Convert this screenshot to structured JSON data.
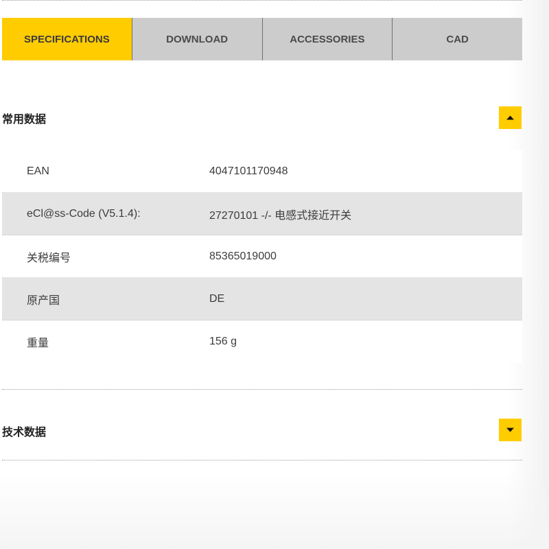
{
  "tabs": [
    {
      "label": "SPECIFICATIONS",
      "active": true
    },
    {
      "label": "DOWNLOAD",
      "active": false
    },
    {
      "label": "ACCESSORIES",
      "active": false
    },
    {
      "label": "CAD",
      "active": false
    }
  ],
  "general_section": {
    "title": "常用数据",
    "expanded": true,
    "toggle_icon": "chevron-up-icon",
    "rows": [
      {
        "label": "EAN",
        "value": "4047101170948"
      },
      {
        "label": "eCl@ss-Code (V5.1.4):",
        "value": "27270101 -/- 电感式接近开关"
      },
      {
        "label": "关税编号",
        "value": "85365019000"
      },
      {
        "label": "原产国",
        "value": "DE"
      },
      {
        "label": "重量",
        "value": "156 g"
      }
    ]
  },
  "technical_section": {
    "title": "技术数据",
    "expanded": false,
    "toggle_icon": "chevron-down-icon"
  },
  "colors": {
    "accent": "#ffcc00",
    "tab_inactive": "#cccccc",
    "row_alt": "#e4e4e4"
  }
}
